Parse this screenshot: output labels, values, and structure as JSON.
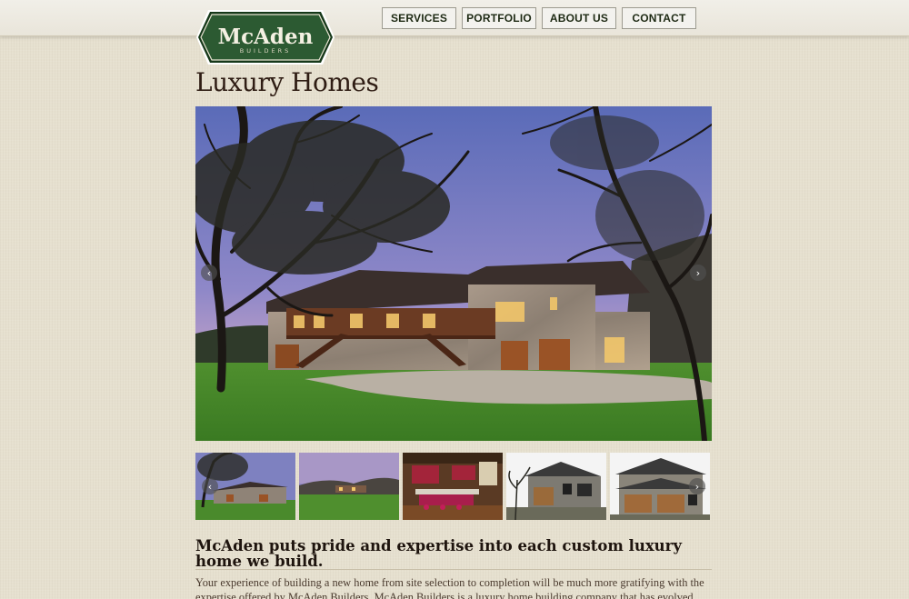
{
  "brand": {
    "name_main": "McAden",
    "name_sub": "BUILDERS",
    "colors": {
      "logo_green": "#2c5a32",
      "logo_dark": "#153819",
      "text_brown": "#2f1d14"
    }
  },
  "nav": {
    "items": [
      {
        "label": "SERVICES"
      },
      {
        "label": "PORTFOLIO"
      },
      {
        "label": "ABOUT US"
      },
      {
        "label": "CONTACT"
      }
    ]
  },
  "page": {
    "title": "Luxury Homes",
    "headline": "McAden puts pride and expertise into each custom luxury home we build.",
    "body": "Your experience of building a new home from site selection to completion will be much more gratifying with the expertise offered by McAden Builders. McAden Builders is a luxury home building company that has evolved over the years to"
  },
  "slider": {
    "prev_icon": "chevron-left-icon",
    "next_icon": "chevron-right-icon",
    "prev_glyph": "‹",
    "next_glyph": "›",
    "thumb_count": 5
  }
}
